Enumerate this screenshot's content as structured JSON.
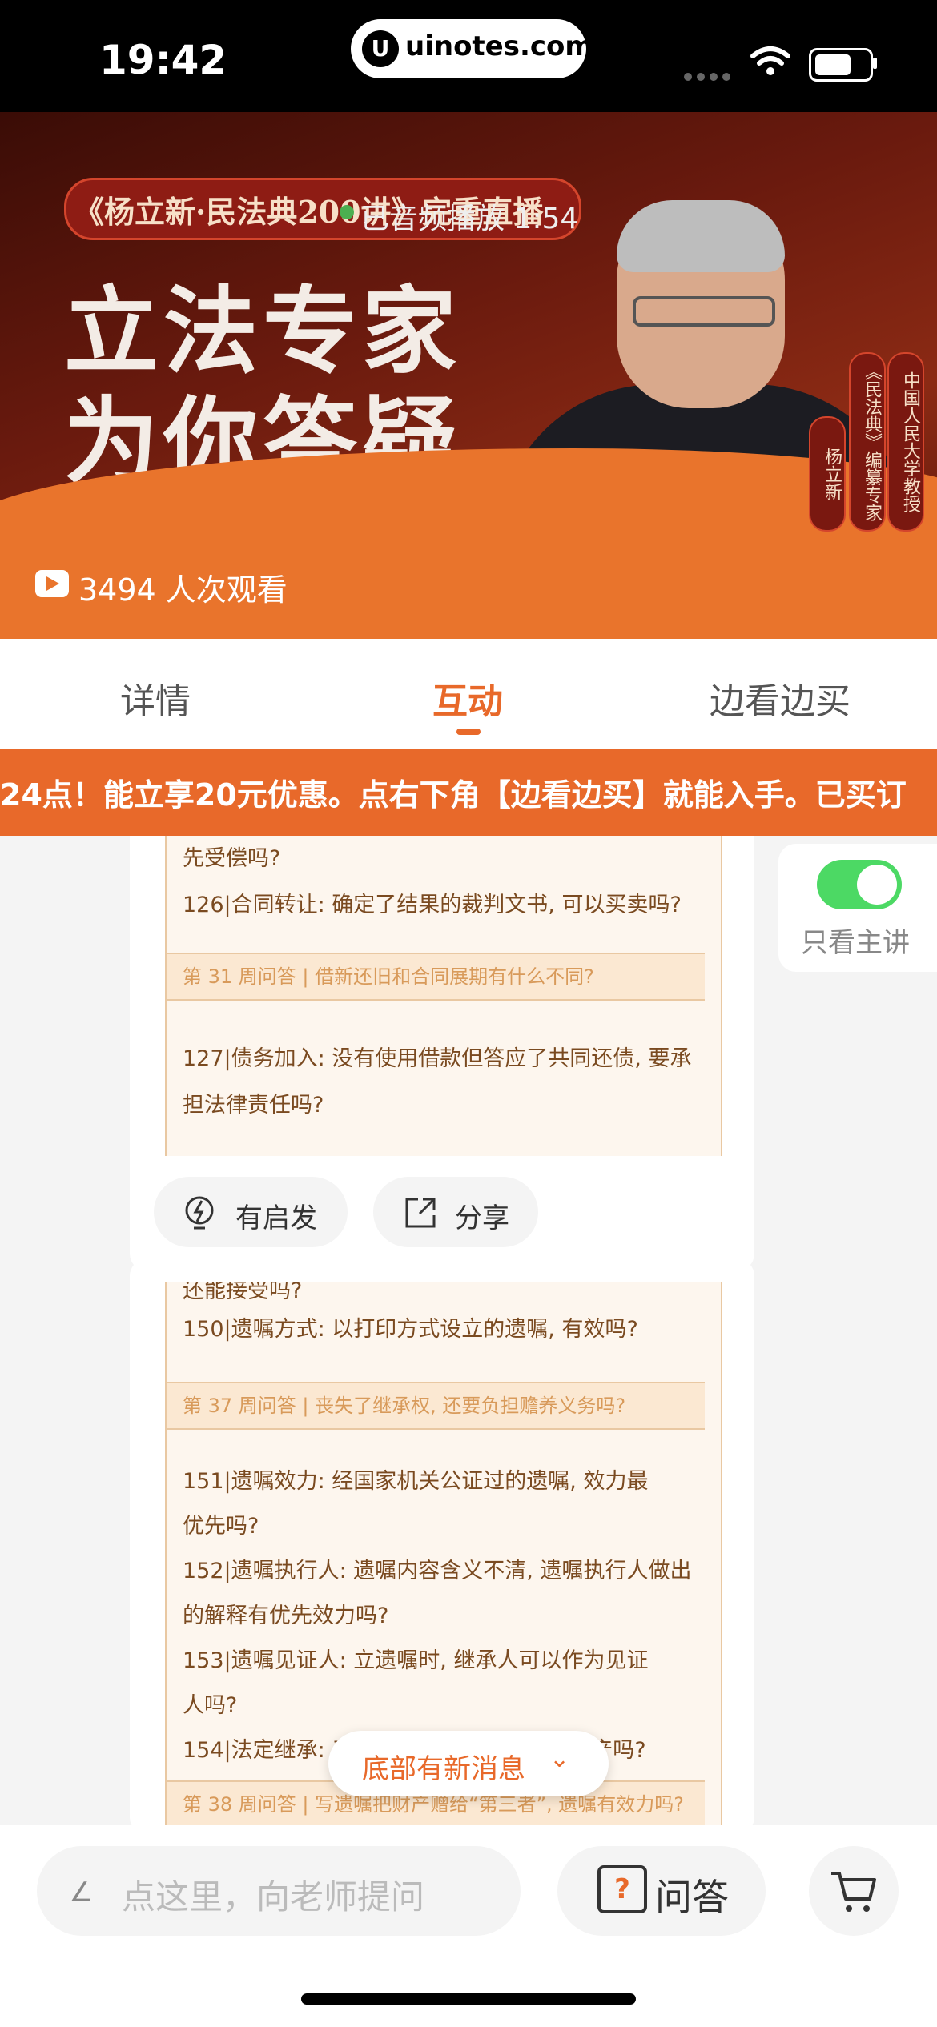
{
  "status_bar": {
    "time": "19:42",
    "url": "uinotes.com"
  },
  "banner": {
    "pill_text": "《杨立新·民法典200讲》完重直播",
    "replay_text": "已音频播放 1:54",
    "headline_line1": "立法专家",
    "headline_line2": "为你答疑",
    "vertical_tags": [
      "杨立新",
      "《民法典》编纂专家",
      "中国人民大学教授"
    ],
    "views": "3494 人次观看"
  },
  "tabs": {
    "detail": "详情",
    "interact": "互动",
    "buy": "边看边买",
    "active": "互动"
  },
  "marquee": "24点！能立享20元优惠。点右下角【边看边买】就能入手。已买订",
  "toggle": {
    "label": "只看主讲",
    "on": true
  },
  "cards": [
    {
      "lines": [
        {
          "text": "先受偿吗?",
          "kind": "q"
        },
        {
          "text": "126|合同转让: 确定了结果的裁判文书, 可以买卖吗?",
          "kind": "q"
        },
        {
          "text": "第 31 周问答 | 借新还旧和合同展期有什么不同?",
          "kind": "section"
        },
        {
          "text": "127|债务加入: 没有使用借款但答应了共同还债, 要承",
          "kind": "q"
        },
        {
          "text": "担法律责任吗?",
          "kind": "q"
        }
      ],
      "actions": {
        "inspire": "有启发",
        "share": "分享"
      }
    },
    {
      "lines": [
        {
          "text": "还能接受吗?",
          "kind": "q"
        },
        {
          "text": "150|遗嘱方式: 以打印方式设立的遗嘱, 有效吗?",
          "kind": "q"
        },
        {
          "text": "第 37 周问答 | 丧失了继承权, 还要负担赡养义务吗?",
          "kind": "section"
        },
        {
          "text": "151|遗嘱效力: 经国家机关公证过的遗嘱, 效力最",
          "kind": "q"
        },
        {
          "text": "优先吗?",
          "kind": "q"
        },
        {
          "text": "152|遗嘱执行人: 遗嘱内容含义不清, 遗嘱执行人做出",
          "kind": "q"
        },
        {
          "text": "的解释有优先效力吗?",
          "kind": "q"
        },
        {
          "text": "153|遗嘱见证人: 立遗嘱时, 继承人可以作为见证",
          "kind": "q"
        },
        {
          "text": "人吗?",
          "kind": "q"
        },
        {
          "text": "154|法定继承: 五代以外的亲属可以继承遗产吗?",
          "kind": "q"
        },
        {
          "text": "第 38 周问答 | 写遗嘱把财产赠给“第三者”, 遗嘱有效力吗?",
          "kind": "section"
        }
      ]
    }
  ],
  "new_message": "底部有新消息",
  "bottom_bar": {
    "ask_placeholder": "点这里，向老师提问",
    "qa_label": "问答",
    "qa_icon": "?"
  },
  "icons": {
    "accent": "#e8692a",
    "toggle_on": "#4cd964"
  }
}
